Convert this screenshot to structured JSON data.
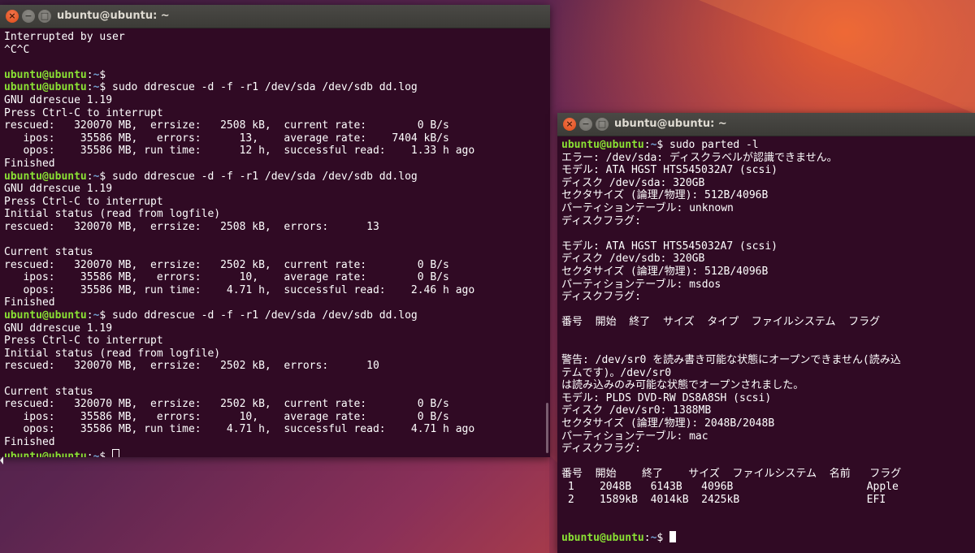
{
  "colors": {
    "terminal_bg": "#300a24",
    "prompt_user": "#8ae234",
    "prompt_path": "#729fcf",
    "text": "#ffffff",
    "titlebar": "#3c3b37",
    "close_button": "#df4a16"
  },
  "window_left": {
    "title": "ubuntu@ubuntu: ~",
    "lines": [
      {
        "text": "Interrupted by user"
      },
      {
        "text": "^C^C"
      },
      {
        "text": ""
      },
      {
        "prompt": "ubuntu@ubuntu",
        "path": "~",
        "text": "$"
      },
      {
        "prompt": "ubuntu@ubuntu",
        "path": "~",
        "text": "$ sudo ddrescue -d -f -r1 /dev/sda /dev/sdb dd.log"
      },
      {
        "text": "GNU ddrescue 1.19"
      },
      {
        "text": "Press Ctrl-C to interrupt"
      },
      {
        "text": "rescued:   320070 MB,  errsize:   2508 kB,  current rate:        0 B/s"
      },
      {
        "text": "   ipos:    35586 MB,   errors:      13,    average rate:    7404 kB/s"
      },
      {
        "text": "   opos:    35586 MB, run time:      12 h,  successful read:    1.33 h ago"
      },
      {
        "text": "Finished"
      },
      {
        "prompt": "ubuntu@ubuntu",
        "path": "~",
        "text": "$ sudo ddrescue -d -f -r1 /dev/sda /dev/sdb dd.log"
      },
      {
        "text": "GNU ddrescue 1.19"
      },
      {
        "text": "Press Ctrl-C to interrupt"
      },
      {
        "text": "Initial status (read from logfile)"
      },
      {
        "text": "rescued:   320070 MB,  errsize:   2508 kB,  errors:      13"
      },
      {
        "text": ""
      },
      {
        "text": "Current status"
      },
      {
        "text": "rescued:   320070 MB,  errsize:   2502 kB,  current rate:        0 B/s"
      },
      {
        "text": "   ipos:    35586 MB,   errors:      10,    average rate:        0 B/s"
      },
      {
        "text": "   opos:    35586 MB, run time:    4.71 h,  successful read:    2.46 h ago"
      },
      {
        "text": "Finished"
      },
      {
        "prompt": "ubuntu@ubuntu",
        "path": "~",
        "text": "$ sudo ddrescue -d -f -r1 /dev/sda /dev/sdb dd.log"
      },
      {
        "text": "GNU ddrescue 1.19"
      },
      {
        "text": "Press Ctrl-C to interrupt"
      },
      {
        "text": "Initial status (read from logfile)"
      },
      {
        "text": "rescued:   320070 MB,  errsize:   2502 kB,  errors:      10"
      },
      {
        "text": ""
      },
      {
        "text": "Current status"
      },
      {
        "text": "rescued:   320070 MB,  errsize:   2502 kB,  current rate:        0 B/s"
      },
      {
        "text": "   ipos:    35586 MB,   errors:      10,    average rate:        0 B/s"
      },
      {
        "text": "   opos:    35586 MB, run time:    4.71 h,  successful read:    4.71 h ago"
      },
      {
        "text": "Finished"
      },
      {
        "prompt": "ubuntu@ubuntu",
        "path": "~",
        "text": "$ ",
        "cursor": "hollow"
      }
    ]
  },
  "window_right": {
    "title": "ubuntu@ubuntu: ~",
    "lines": [
      {
        "prompt": "ubuntu@ubuntu",
        "path": "~",
        "text": "$ sudo parted -l"
      },
      {
        "text": "エラー: /dev/sda: ディスクラベルが認識できません。"
      },
      {
        "text": "モデル: ATA HGST HTS545032A7 (scsi)"
      },
      {
        "text": "ディスク /dev/sda: 320GB"
      },
      {
        "text": "セクタサイズ (論理/物理): 512B/4096B"
      },
      {
        "text": "パーティションテーブル: unknown"
      },
      {
        "text": "ディスクフラグ:"
      },
      {
        "text": ""
      },
      {
        "text": "モデル: ATA HGST HTS545032A7 (scsi)"
      },
      {
        "text": "ディスク /dev/sdb: 320GB"
      },
      {
        "text": "セクタサイズ (論理/物理): 512B/4096B"
      },
      {
        "text": "パーティションテーブル: msdos"
      },
      {
        "text": "ディスクフラグ:"
      },
      {
        "text": ""
      },
      {
        "text": "番号  開始  終了  サイズ  タイプ  ファイルシステム  フラグ"
      },
      {
        "text": ""
      },
      {
        "text": ""
      },
      {
        "text": "警告: /dev/sr0 を読み書き可能な状態にオープンできません(読み込"
      },
      {
        "text": "テムです)。/dev/sr0"
      },
      {
        "text": "は読み込みのみ可能な状態でオープンされました。"
      },
      {
        "text": "モデル: PLDS DVD-RW DS8A8SH (scsi)"
      },
      {
        "text": "ディスク /dev/sr0: 1388MB"
      },
      {
        "text": "セクタサイズ (論理/物理): 2048B/2048B"
      },
      {
        "text": "パーティションテーブル: mac"
      },
      {
        "text": "ディスクフラグ:"
      },
      {
        "text": ""
      },
      {
        "text": "番号  開始    終了    サイズ  ファイルシステム  名前   フラグ"
      },
      {
        "text": " 1    2048B   6143B   4096B                     Apple"
      },
      {
        "text": " 2    1589kB  4014kB  2425kB                    EFI"
      },
      {
        "text": ""
      },
      {
        "text": ""
      },
      {
        "prompt": "ubuntu@ubuntu",
        "path": "~",
        "text": "$ ",
        "cursor": "solid"
      }
    ]
  }
}
